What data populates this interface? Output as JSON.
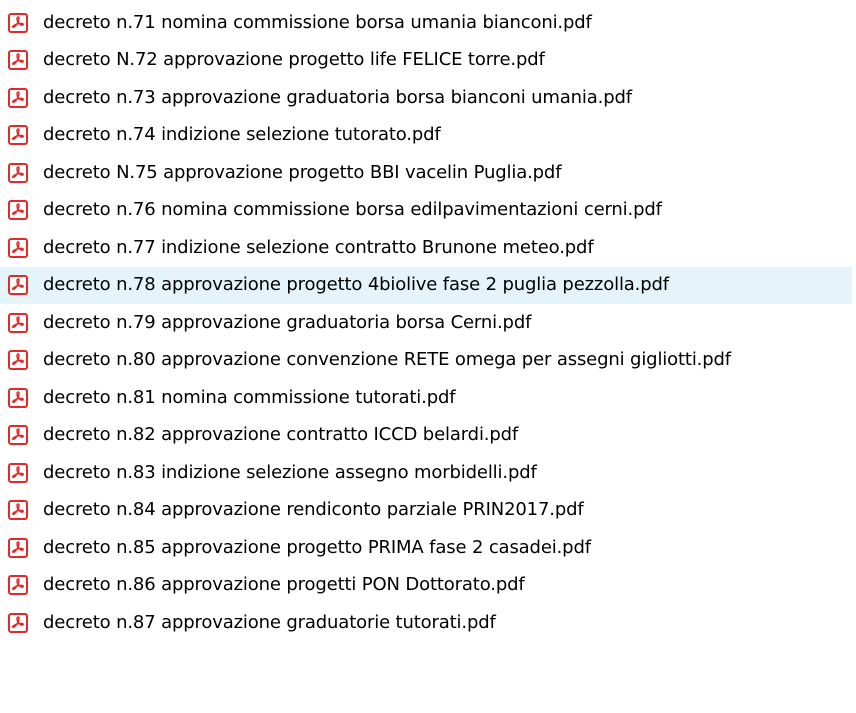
{
  "file_list": {
    "icon": "pdf-file-icon",
    "accent_color": "#e02b2b",
    "selected_index": 7,
    "selected_color": "#e5f3fb",
    "items": [
      {
        "name": "decreto n.71 nomina commissione borsa umania bianconi.pdf"
      },
      {
        "name": "decreto N.72 approvazione progetto life FELICE torre.pdf"
      },
      {
        "name": "decreto n.73 approvazione graduatoria borsa bianconi umania.pdf"
      },
      {
        "name": "decreto n.74 indizione selezione tutorato.pdf"
      },
      {
        "name": "decreto N.75 approvazione progetto BBI vacelin Puglia.pdf"
      },
      {
        "name": "decreto n.76 nomina commissione borsa edilpavimentazioni cerni.pdf"
      },
      {
        "name": "decreto n.77 indizione selezione contratto Brunone meteo.pdf"
      },
      {
        "name": "decreto n.78 approvazione progetto 4biolive fase 2 puglia pezzolla.pdf"
      },
      {
        "name": "decreto n.79 approvazione graduatoria borsa Cerni.pdf"
      },
      {
        "name": "decreto n.80 approvazione convenzione RETE omega per assegni gigliotti.pdf"
      },
      {
        "name": "decreto n.81 nomina commissione tutorati.pdf"
      },
      {
        "name": "decreto n.82 approvazione contratto ICCD belardi.pdf"
      },
      {
        "name": "decreto n.83 indizione selezione assegno morbidelli.pdf"
      },
      {
        "name": "decreto n.84 approvazione rendiconto parziale PRIN2017.pdf"
      },
      {
        "name": "decreto n.85 approvazione progetto PRIMA fase 2 casadei.pdf"
      },
      {
        "name": "decreto n.86 approvazione progetti PON Dottorato.pdf"
      },
      {
        "name": "decreto n.87 approvazione graduatorie tutorati.pdf"
      }
    ]
  }
}
